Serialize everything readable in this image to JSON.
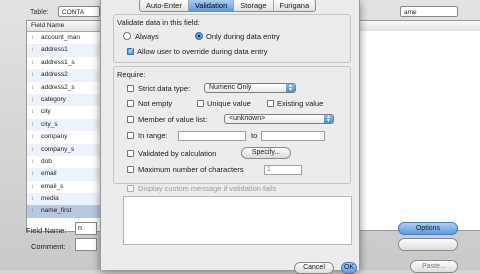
{
  "background": {
    "table_label": "Table:",
    "table_value": "CONTA",
    "view_value": "ame",
    "field_list_header": "Field Name",
    "fields": [
      "account_man",
      "address1",
      "address1_s",
      "address2",
      "address2_s",
      "category",
      "city",
      "city_s",
      "company",
      "company_s",
      "dob",
      "email",
      "email_s",
      "media",
      "name_first"
    ],
    "selected_field": "name_first",
    "field_name_label": "Field Name:",
    "field_name_value": "n",
    "comment_label": "Comment:",
    "options_button": "Options",
    "paste_button": "Paste..."
  },
  "dialog": {
    "tabs": [
      "Auto-Enter",
      "Validation",
      "Storage",
      "Furigana"
    ],
    "active_tab": "Validation",
    "validate_title": "Validate data in this field:",
    "always_label": "Always",
    "only_entry_label": "Only during data entry",
    "allow_override_label": "Allow user to override during data entry",
    "require_title": "Require:",
    "strict_type_label": "Strict data type:",
    "strict_type_value": "Numeric Only",
    "not_empty_label": "Not empty",
    "unique_label": "Unique value",
    "existing_label": "Existing value",
    "member_label": "Member of value list:",
    "member_value": "<unknown>",
    "in_range_label": "In range:",
    "to_label": "to",
    "calc_label": "Validated by calculation",
    "specify_button": "Specify...",
    "max_chars_label": "Maximum number of characters",
    "max_chars_value": "1",
    "custom_message_label": "Display custom message if validation fails",
    "cancel_button": "Cancel",
    "ok_button": "OK"
  }
}
